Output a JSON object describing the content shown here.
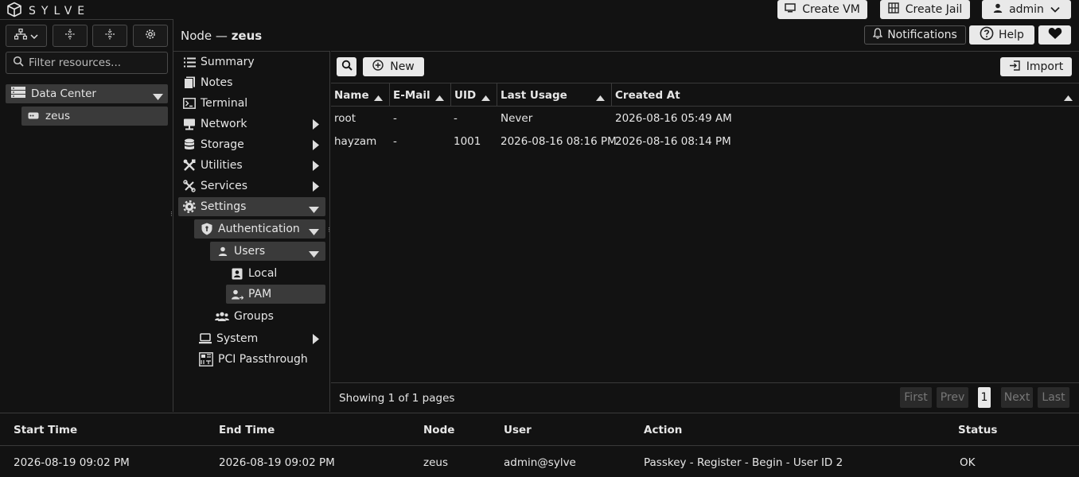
{
  "app": {
    "name": "SYLVE"
  },
  "topbar": {
    "create_vm": "Create VM",
    "create_jail": "Create Jail",
    "user": "admin"
  },
  "left": {
    "filter_placeholder": "Filter resources...",
    "tree": {
      "datacenter": "Data Center",
      "node": "zeus"
    }
  },
  "header": {
    "title_prefix": "Node — ",
    "title_node": "zeus",
    "notifications": "Notifications",
    "help": "Help"
  },
  "nav": {
    "summary": "Summary",
    "notes": "Notes",
    "terminal": "Terminal",
    "network": "Network",
    "storage": "Storage",
    "utilities": "Utilities",
    "services": "Services",
    "settings": "Settings",
    "authentication": "Authentication",
    "users": "Users",
    "local": "Local",
    "pam": "PAM",
    "groups": "Groups",
    "system": "System",
    "pci": "PCI Passthrough"
  },
  "toolbar": {
    "new": "New",
    "import": "Import"
  },
  "table": {
    "columns": [
      "Name",
      "E-Mail",
      "UID",
      "Last Usage",
      "Created At"
    ],
    "rows": [
      [
        "root",
        "-",
        "-",
        "Never",
        "2026-08-16 05:49 AM"
      ],
      [
        "hayzam",
        "-",
        "1001",
        "2026-08-16 08:16 PM",
        "2026-08-16 08:14 PM"
      ]
    ]
  },
  "pager": {
    "status": "Showing 1 of 1 pages",
    "first": "First",
    "prev": "Prev",
    "page": "1",
    "next": "Next",
    "last": "Last"
  },
  "log": {
    "columns": [
      "Start Time",
      "End Time",
      "Node",
      "User",
      "Action",
      "Status"
    ],
    "row": [
      "2026-08-19 09:02 PM",
      "2026-08-19 09:02 PM",
      "zeus",
      "admin@sylve",
      "Passkey - Register - Begin - User ID 2",
      "OK"
    ]
  }
}
